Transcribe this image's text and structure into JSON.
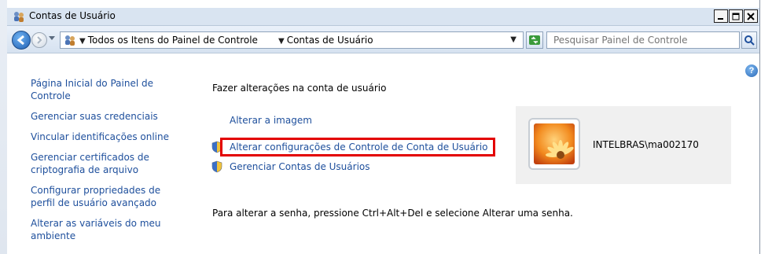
{
  "window": {
    "title": "Contas de Usuário"
  },
  "address_bar": {
    "crumb_1": "Todos os Itens do Painel de Controle",
    "crumb_2": "Contas de Usuário"
  },
  "search": {
    "placeholder": "Pesquisar Painel de Controle"
  },
  "sidebar": {
    "items": [
      "Página Inicial do Painel de Controle",
      "Gerenciar suas credenciais",
      "Vincular identificações online",
      "Gerenciar certificados de criptografia de arquivo",
      "Configurar propriedades de perfil de usuário avançado",
      "Alterar as variáveis do meu ambiente"
    ]
  },
  "main": {
    "heading": "Fazer alterações na conta de usuário",
    "change_picture": "Alterar a imagem",
    "uac_settings": "Alterar configurações de Controle de Conta de Usuário",
    "manage_accounts": "Gerenciar Contas de Usuários",
    "password_note": "Para alterar a senha, pressione Ctrl+Alt+Del e selecione Alterar uma senha."
  },
  "user": {
    "name": "INTELBRAS\\ma002170"
  },
  "colors": {
    "link": "#1e4f9c",
    "highlight": "#e30000"
  },
  "icons": {
    "title": "user-accounts-icon",
    "shield": "uac-shield-icon",
    "help": "help-icon"
  }
}
